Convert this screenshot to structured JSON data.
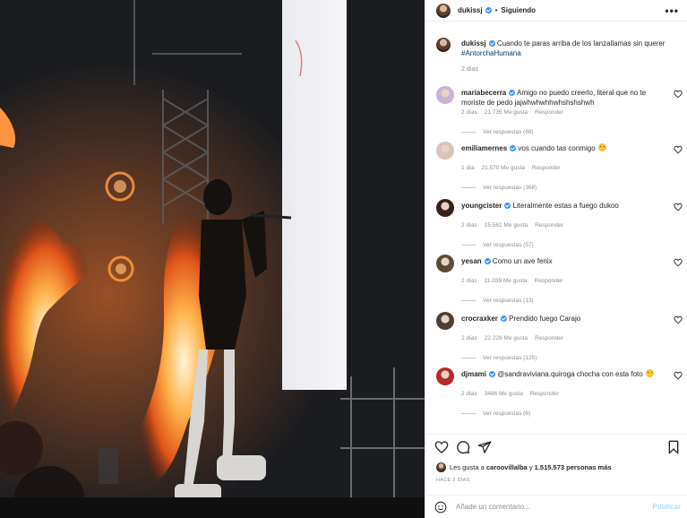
{
  "header": {
    "username": "dukissj",
    "separator": "•",
    "follow_status": "Siguiendo",
    "more": "•••"
  },
  "caption": {
    "username": "dukissj",
    "text": "Cuando te paras arriba de los lanzallamas sin querer",
    "hashtag": "#AntorchaHumana",
    "time": "2 días"
  },
  "comments": [
    {
      "username": "mariabecerra",
      "text": "Amigo no puedo creerlo, literal que no te moriste de pedo jajwhwhwhhwhshshshwh",
      "time": "2 días",
      "likes": "21.735 Me gusta",
      "reply": "Responder",
      "replies": "Ver respuestas (68)",
      "emoji": false
    },
    {
      "username": "emiliamernes",
      "text": "vos cuando tas conmigo",
      "time": "1 día",
      "likes": "21.570 Me gusta",
      "reply": "Responder",
      "replies": "Ver respuestas (368)",
      "emoji": true
    },
    {
      "username": "youngcister",
      "text": "Literalmente estas a fuego dukoo",
      "time": "2 días",
      "likes": "15.561 Me gusta",
      "reply": "Responder",
      "replies": "Ver respuestas (57)",
      "emoji": false
    },
    {
      "username": "yesan",
      "text": "Como un ave fenix",
      "time": "2 días",
      "likes": "11.039 Me gusta",
      "reply": "Responder",
      "replies": "Ver respuestas (13)",
      "emoji": false
    },
    {
      "username": "crocraxker",
      "text": "Prendido fuego Carajo",
      "time": "2 días",
      "likes": "22.228 Me gusta",
      "reply": "Responder",
      "replies": "Ver respuestas (125)",
      "emoji": false
    },
    {
      "username": "djmami",
      "text": "@sandraviviana.quiroga chocha con esta foto",
      "time": "2 días",
      "likes": "3486 Me gusta",
      "reply": "Responder",
      "replies": "Ver respuestas (6)",
      "emoji": true
    }
  ],
  "actions": {
    "icons": [
      "heart-icon",
      "comment-icon",
      "share-icon",
      "bookmark-icon"
    ]
  },
  "likes": {
    "prefix": "Les gusta a",
    "user": "caroovillalba",
    "conj": "y",
    "count": "1.515.573 personas más"
  },
  "post_time": "HACE 2 DÍAS",
  "add_comment": {
    "placeholder": "Añade un comentario...",
    "publish": "Publicar"
  },
  "colors": {
    "verified": "#3897f0",
    "hashtag": "#00376b",
    "publish_disabled": "#b3dbff",
    "muted": "#8e8e8e"
  }
}
